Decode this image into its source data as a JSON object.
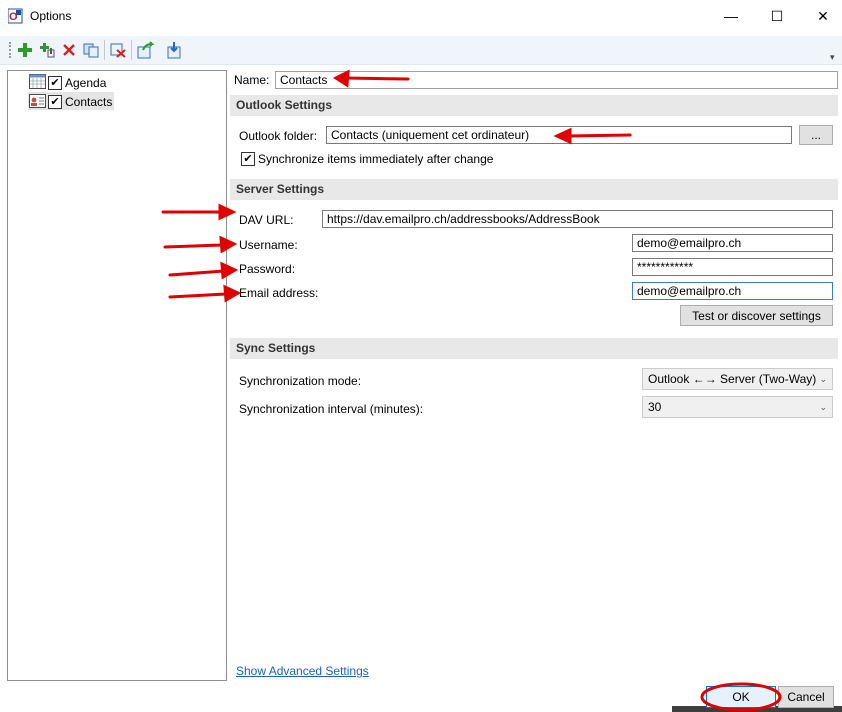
{
  "window": {
    "title": "Options",
    "minimize_glyph": "—",
    "maximize_glyph": "☐",
    "close_glyph": "✕"
  },
  "toolbar": {
    "icons": [
      "add-icon",
      "add-multiple-icon",
      "delete-icon",
      "copy-icon",
      "clear-cache-icon",
      "export-icon",
      "import-icon"
    ],
    "overflow_glyph": "▾"
  },
  "tree": {
    "items": [
      {
        "label": "Agenda",
        "checked": true,
        "icon": "calendar-icon"
      },
      {
        "label": "Contacts",
        "checked": true,
        "icon": "contacts-icon"
      }
    ]
  },
  "profile": {
    "name_label": "Name:",
    "name_value": "Contacts"
  },
  "outlook_settings": {
    "header": "Outlook Settings",
    "folder_label": "Outlook folder:",
    "folder_value": "Contacts (uniquement cet ordinateur)",
    "browse_label": "...",
    "sync_immediately_label": "Synchronize items immediately after change",
    "sync_immediately_checked": true
  },
  "server_settings": {
    "header": "Server Settings",
    "dav_url_label": "DAV URL:",
    "dav_url_value": "https://dav.emailpro.ch/addressbooks/AddressBook",
    "username_label": "Username:",
    "username_value": "demo@emailpro.ch",
    "password_label": "Password:",
    "password_value": "************",
    "email_label": "Email address:",
    "email_value": "demo@emailpro.ch",
    "test_button": "Test or discover settings"
  },
  "sync_settings": {
    "header": "Sync Settings",
    "mode_label": "Synchronization mode:",
    "mode_value": "Outlook ←→ Server (Two-Way)",
    "interval_label": "Synchronization interval (minutes):",
    "interval_value": "30"
  },
  "footer": {
    "advanced_link": "Show Advanced Settings",
    "ok_button": "OK",
    "cancel_button": "Cancel"
  },
  "colors": {
    "annotation_red": "#e00000",
    "section_bg": "#e8e8e8",
    "link_blue": "#1f5fbf",
    "toolbar_bg": "#f0f5fb"
  }
}
